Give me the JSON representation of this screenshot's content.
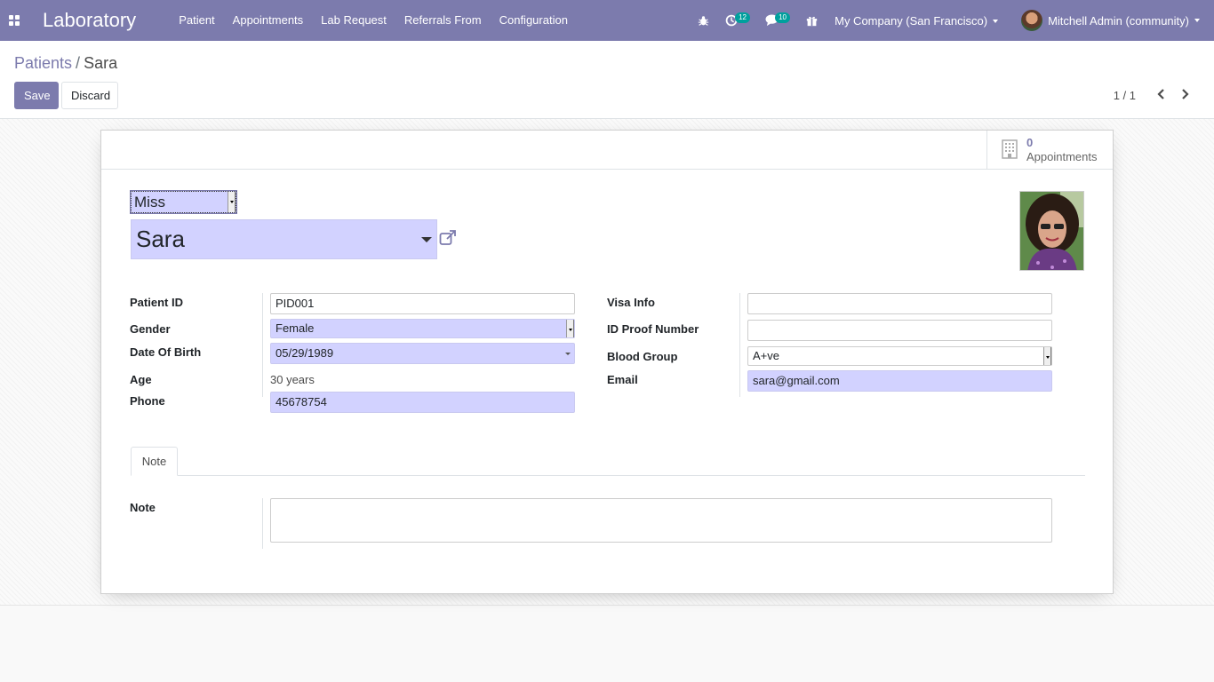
{
  "navbar": {
    "app_title": "Laboratory",
    "menu": [
      "Patient",
      "Appointments",
      "Lab Request",
      "Referrals From",
      "Configuration"
    ],
    "activity_count": "12",
    "message_count": "10",
    "company": "My Company (San Francisco)",
    "user": "Mitchell Admin (community)"
  },
  "breadcrumb": {
    "parent": "Patients",
    "separator": "/",
    "current": "Sara"
  },
  "buttons": {
    "save": "Save",
    "discard": "Discard"
  },
  "pager": {
    "value": "1 / 1"
  },
  "stat_button": {
    "value": "0",
    "label": "Appointments"
  },
  "form": {
    "title": "Miss",
    "name": "Sara",
    "left": {
      "patient_id_label": "Patient ID",
      "patient_id": "PID001",
      "gender_label": "Gender",
      "gender": "Female",
      "dob_label": "Date Of Birth",
      "dob": "05/29/1989",
      "age_label": "Age",
      "age": "30 years",
      "phone_label": "Phone",
      "phone": "45678754"
    },
    "right": {
      "visa_label": "Visa Info",
      "visa": "",
      "id_proof_label": "ID Proof Number",
      "id_proof": "",
      "blood_group_label": "Blood Group",
      "blood_group": "A+ve",
      "email_label": "Email",
      "email": "sara@gmail.com"
    },
    "tab": "Note",
    "note_label": "Note",
    "note": ""
  },
  "colors": {
    "brand": "#7c7bad",
    "required_field": "#d2d2ff",
    "badge": "#00a09d"
  }
}
